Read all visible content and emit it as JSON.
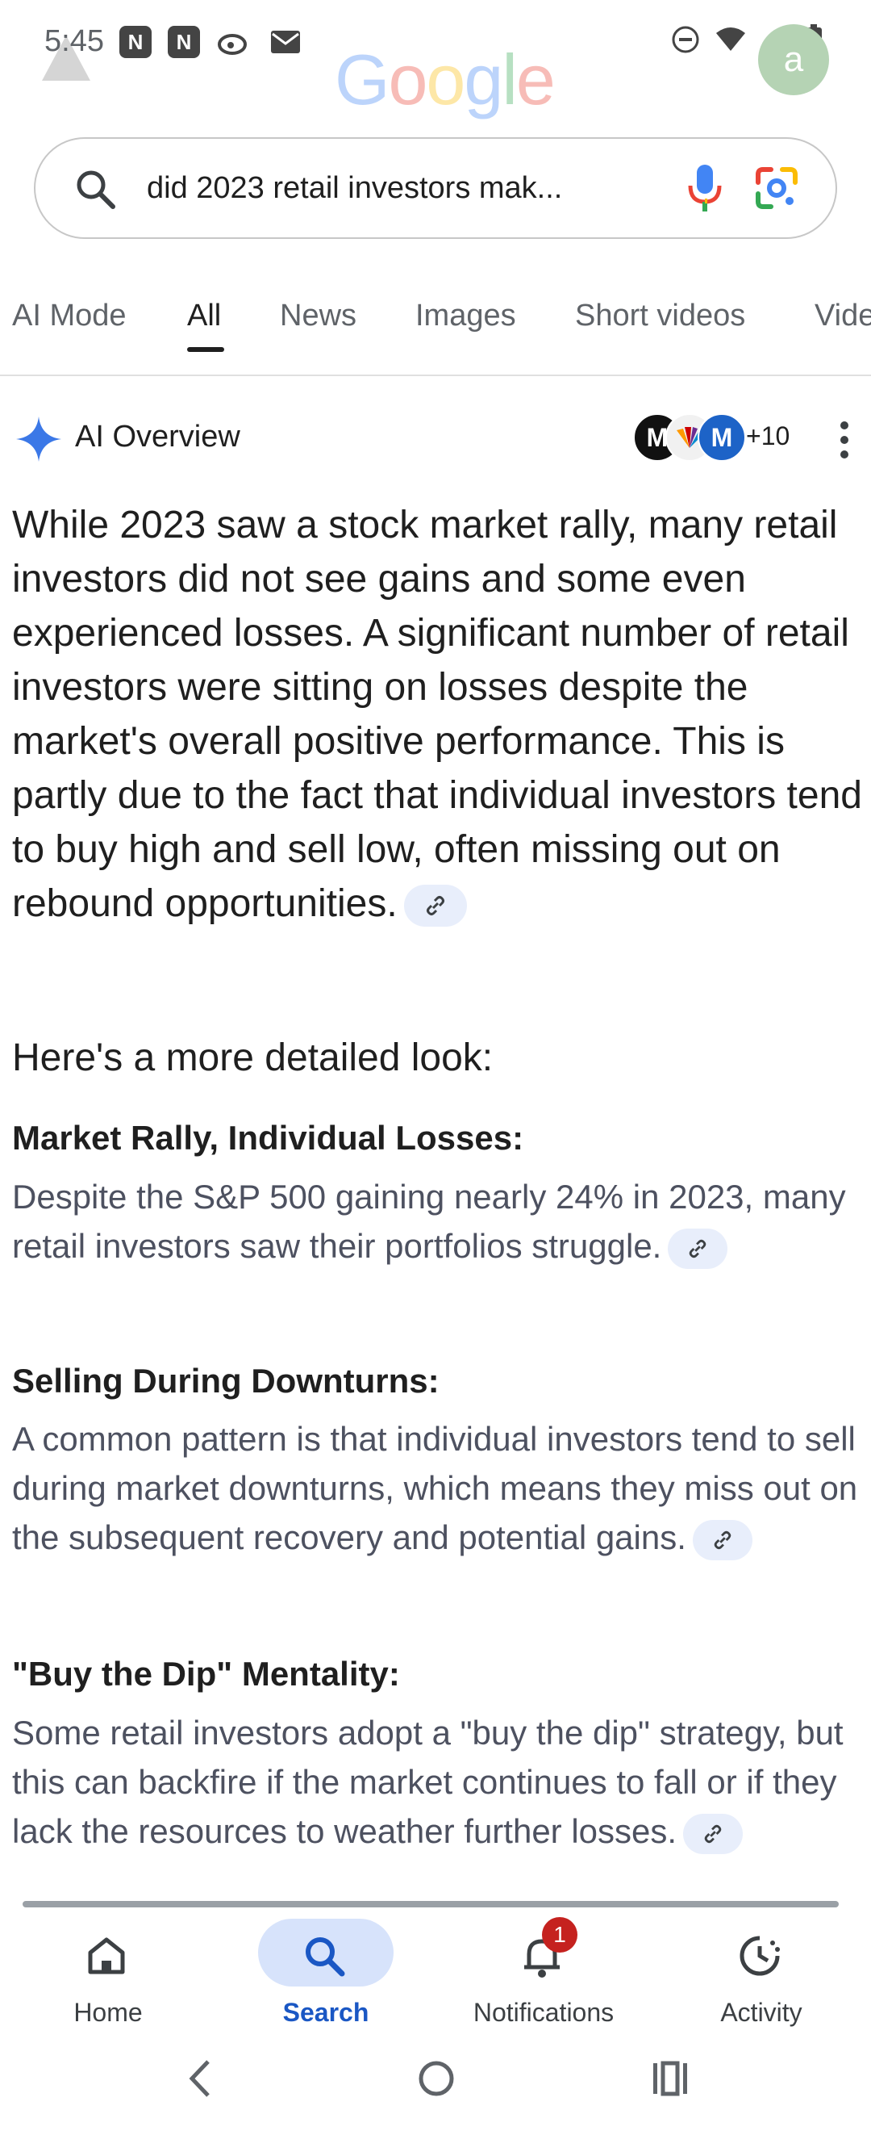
{
  "status_bar": {
    "time": "5:45"
  },
  "header": {
    "logo": "Google",
    "avatar_letter": "a"
  },
  "search": {
    "query": "did 2023 retail investors mak..."
  },
  "tabs": [
    {
      "label": "AI Mode"
    },
    {
      "label": "All"
    },
    {
      "label": "News"
    },
    {
      "label": "Images"
    },
    {
      "label": "Short videos"
    },
    {
      "label": "Vide"
    }
  ],
  "ai_overview": {
    "title": "AI Overview",
    "sources_count": "+10",
    "summary": "While 2023 saw a stock market rally, many retail investors did not see gains and some even experienced losses. A significant number of retail investors were sitting on losses despite the market's overall positive performance. This is partly due to the fact that individual investors tend to buy high and sell low, often missing out on rebound opportunities.",
    "section_heading": "Here's a more detailed look:",
    "items": [
      {
        "title": "Market Rally, Individual Losses:",
        "body": "Despite the S&P 500 gaining nearly 24% in 2023, many retail investors saw their portfolios struggle."
      },
      {
        "title": "Selling During Downturns:",
        "body": "A common pattern is that individual investors tend to sell during market downturns, which means they miss out on the subsequent recovery and potential gains."
      },
      {
        "title": "\"Buy the Dip\" Mentality:",
        "body": "Some retail investors adopt a \"buy the dip\" strategy, but this can backfire if the market continues to fall or if they lack the resources to weather further losses."
      }
    ]
  },
  "bottom_nav": {
    "items": [
      {
        "label": "Home"
      },
      {
        "label": "Search"
      },
      {
        "label": "Notifications"
      },
      {
        "label": "Activity"
      }
    ],
    "notification_badge": "1"
  },
  "colors": {
    "accent": "#1a57c4",
    "pill": "#d7e3fb",
    "badge": "#c5221f"
  }
}
